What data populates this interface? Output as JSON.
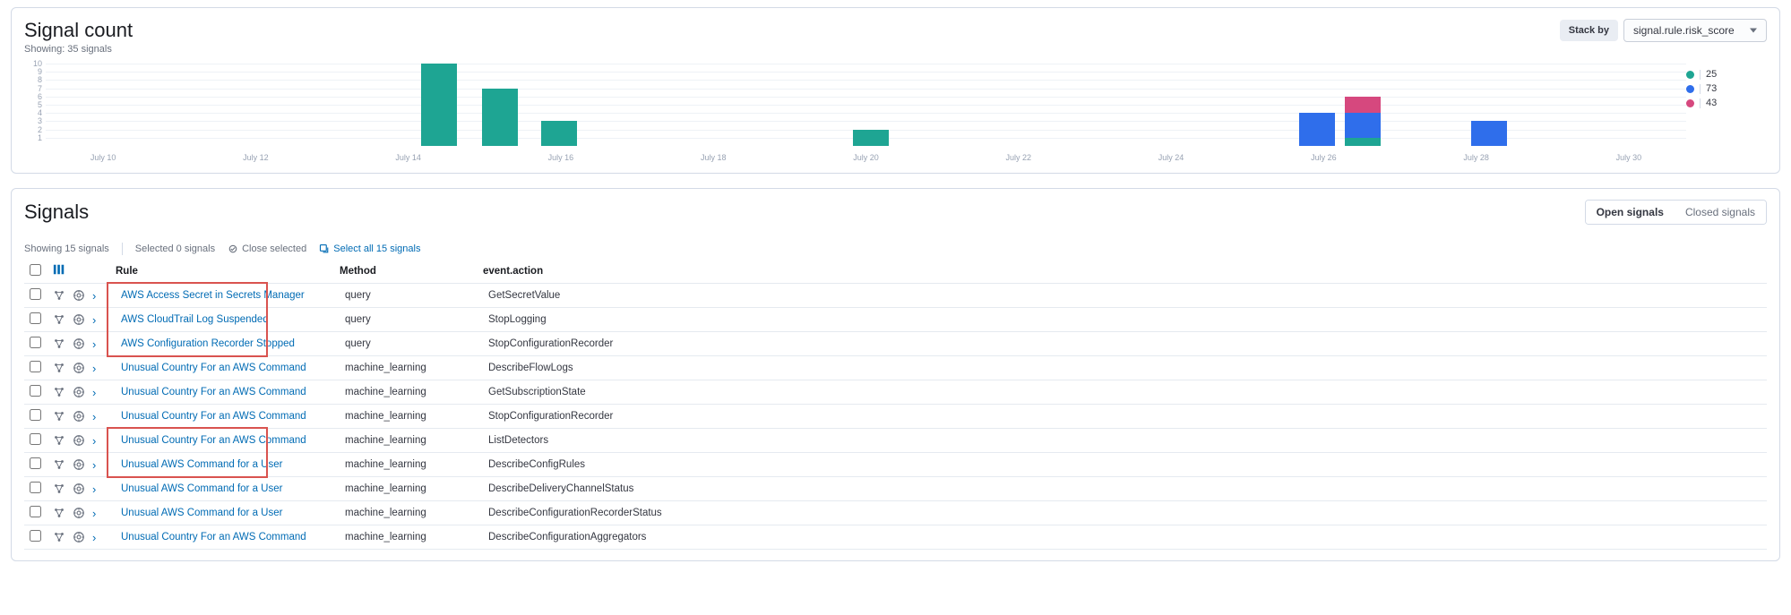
{
  "signalCount": {
    "title": "Signal count",
    "subtitle": "Showing: 35 signals",
    "stackByLabel": "Stack by",
    "stackByValue": "signal.rule.risk_score"
  },
  "chart_data": {
    "type": "bar",
    "title": "Signal count",
    "ylabel": "",
    "xlabel": "",
    "ylim": [
      0,
      10
    ],
    "yticks": [
      1,
      2,
      3,
      4,
      5,
      6,
      7,
      8,
      9,
      10
    ],
    "categories": [
      "July 10",
      "July 12",
      "July 14",
      "July 16",
      "July 18",
      "July 20",
      "July 22",
      "July 24",
      "July 26",
      "July 28",
      "July 30"
    ],
    "legend": [
      {
        "name": "25",
        "color": "#1ea593"
      },
      {
        "name": "73",
        "color": "#2f6eeb"
      },
      {
        "name": "43",
        "color": "#d6487e"
      }
    ],
    "bars": [
      {
        "x": "July 14.5",
        "offsetPct": 24.0,
        "stack": [
          {
            "series": "25",
            "value": 10
          }
        ]
      },
      {
        "x": "July 15.2",
        "offsetPct": 27.7,
        "stack": [
          {
            "series": "25",
            "value": 7
          }
        ]
      },
      {
        "x": "July 16.0",
        "offsetPct": 31.3,
        "stack": [
          {
            "series": "25",
            "value": 3
          }
        ]
      },
      {
        "x": "July 20.3",
        "offsetPct": 50.3,
        "stack": [
          {
            "series": "25",
            "value": 2
          }
        ]
      },
      {
        "x": "July 27.5",
        "offsetPct": 77.5,
        "stack": [
          {
            "series": "73",
            "value": 4
          }
        ]
      },
      {
        "x": "July 28.0",
        "offsetPct": 80.3,
        "stack": [
          {
            "series": "25",
            "value": 1
          },
          {
            "series": "73",
            "value": 3
          },
          {
            "series": "43",
            "value": 2
          }
        ]
      },
      {
        "x": "July 30.0",
        "offsetPct": 88.0,
        "stack": [
          {
            "series": "73",
            "value": 3
          }
        ]
      }
    ]
  },
  "signals": {
    "title": "Signals",
    "tabs": {
      "open": "Open signals",
      "closed": "Closed signals"
    },
    "toolbar": {
      "showing": "Showing 15 signals",
      "selected": "Selected 0 signals",
      "closeSelected": "Close selected",
      "selectAll": "Select all 15 signals"
    },
    "columns": {
      "rule": "Rule",
      "method": "Method",
      "eventAction": "event.action"
    },
    "rows": [
      {
        "rule": "AWS Access Secret in Secrets Manager",
        "method": "query",
        "action": "GetSecretValue",
        "hl": true
      },
      {
        "rule": "AWS CloudTrail Log Suspended",
        "method": "query",
        "action": "StopLogging",
        "hl": true
      },
      {
        "rule": "AWS Configuration Recorder Stopped",
        "method": "query",
        "action": "StopConfigurationRecorder",
        "hl": true
      },
      {
        "rule": "Unusual Country For an AWS Command",
        "method": "machine_learning",
        "action": "DescribeFlowLogs",
        "hl": false
      },
      {
        "rule": "Unusual Country For an AWS Command",
        "method": "machine_learning",
        "action": "GetSubscriptionState",
        "hl": false
      },
      {
        "rule": "Unusual Country For an AWS Command",
        "method": "machine_learning",
        "action": "StopConfigurationRecorder",
        "hl": false
      },
      {
        "rule": "Unusual Country For an AWS Command",
        "method": "machine_learning",
        "action": "ListDetectors",
        "hl": true
      },
      {
        "rule": "Unusual AWS Command for a User",
        "method": "machine_learning",
        "action": "DescribeConfigRules",
        "hl": true
      },
      {
        "rule": "Unusual AWS Command for a User",
        "method": "machine_learning",
        "action": "DescribeDeliveryChannelStatus",
        "hl": false
      },
      {
        "rule": "Unusual AWS Command for a User",
        "method": "machine_learning",
        "action": "DescribeConfigurationRecorderStatus",
        "hl": false
      },
      {
        "rule": "Unusual Country For an AWS Command",
        "method": "machine_learning",
        "action": "DescribeConfigurationAggregators",
        "hl": false
      }
    ]
  }
}
